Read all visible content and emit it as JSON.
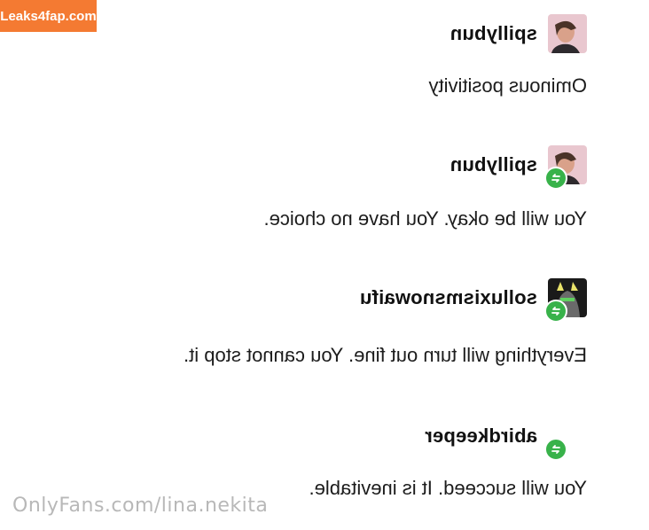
{
  "site_badge": "Leaks4fap.com",
  "watermark": "OnlyFans.com/lina.nekita",
  "posts": [
    {
      "username": "spillybun",
      "avatar_icon": "profile-photo-woman",
      "reblog": false,
      "text": "Ominous positivity"
    },
    {
      "username": "spillybun",
      "avatar_icon": "profile-photo-woman",
      "reblog": true,
      "text": "You will be okay. You have no choice."
    },
    {
      "username": "solluxismsnowaifu",
      "avatar_icon": "profile-avatar-character",
      "reblog": true,
      "text": "Everything will turn out fine. You cannot stop it."
    },
    {
      "username": "abirdkeeper",
      "avatar_icon": "profile-avatar-hidden",
      "reblog": true,
      "text": "You will succeed. It is inevitable."
    }
  ],
  "colors": {
    "reblog_green": "#38b24a",
    "badge_orange": "#f47a32",
    "watermark_gray": "#b8b8b8"
  }
}
